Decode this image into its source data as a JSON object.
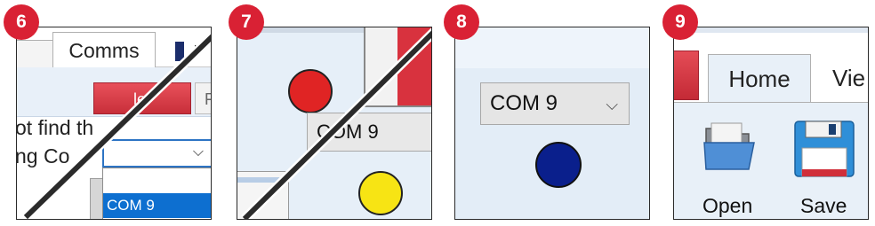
{
  "steps": [
    "6",
    "7",
    "8",
    "9"
  ],
  "panel6": {
    "tab": "Comms",
    "red_tab": "le",
    "gray_tab": "F",
    "label_line1": "ot find th",
    "label_line2": "ng Co",
    "dropdown_chevron": "⌵",
    "dropdown_option": "COM 9"
  },
  "panel7": {
    "combo_value": "COM 9",
    "combo_chevron": "⌵",
    "status_dots": [
      "red",
      "yellow"
    ]
  },
  "panel8": {
    "combo_value": "COM 9",
    "combo_chevron": "⌵",
    "status_dot": "dark-blue"
  },
  "panel9": {
    "tab_home": "Home",
    "tab_view": "Vie",
    "open_label": "Open",
    "save_label": "Save"
  },
  "colors": {
    "badge": "#d92134",
    "selection": "#0d6fd0",
    "dot_red": "#e02424",
    "dot_yellow": "#f7e414",
    "dot_blue": "#0a1f8c"
  }
}
